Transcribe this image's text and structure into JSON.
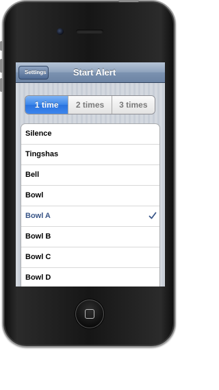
{
  "navbar": {
    "back_label": "Settings",
    "title": "Start Alert"
  },
  "segmented": {
    "options": [
      "1 time",
      "2 times",
      "3 times"
    ],
    "selected_index": 0
  },
  "list": {
    "items": [
      {
        "label": "Silence",
        "selected": false
      },
      {
        "label": "Tingshas",
        "selected": false
      },
      {
        "label": "Bell",
        "selected": false
      },
      {
        "label": "Bowl",
        "selected": false
      },
      {
        "label": "Bowl A",
        "selected": true
      },
      {
        "label": "Bowl B",
        "selected": false
      },
      {
        "label": "Bowl C",
        "selected": false
      },
      {
        "label": "Bowl D",
        "selected": false
      }
    ]
  },
  "colors": {
    "navbar": "#7b92b0",
    "segment_selected": "#3a85ea",
    "selected_text": "#385487",
    "checkmark": "#385487"
  },
  "icons": {
    "checkmark": "checkmark-icon",
    "home_button": "home-button-square-icon",
    "camera": "front-camera-icon",
    "speaker": "speaker-grille-icon"
  }
}
